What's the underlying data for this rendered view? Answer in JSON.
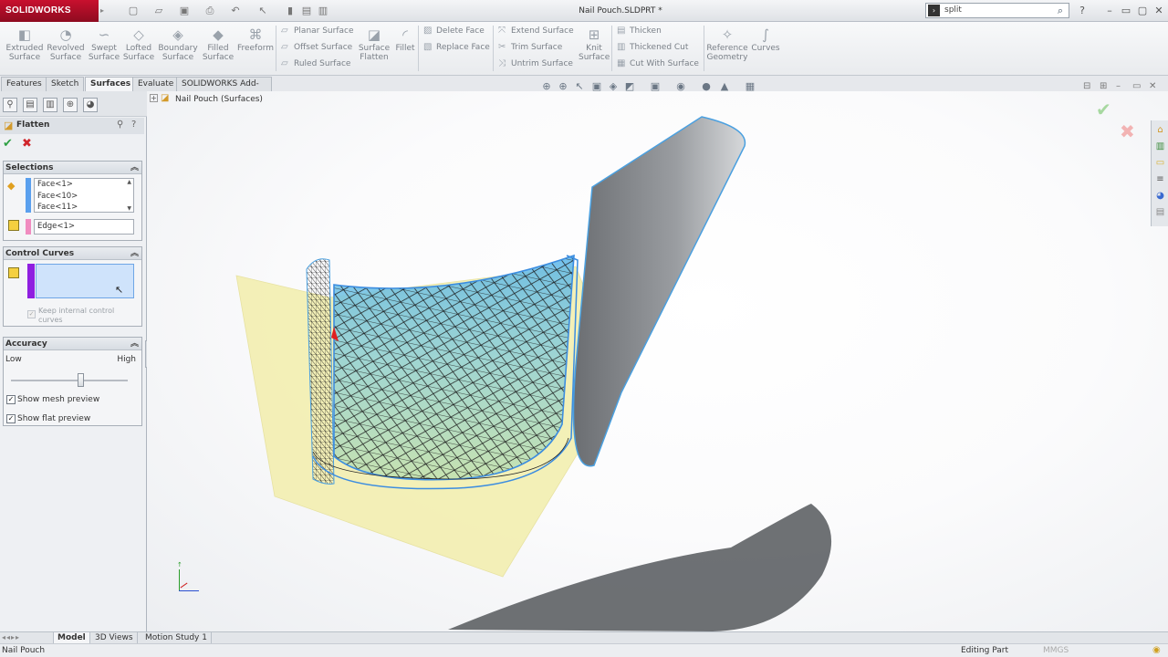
{
  "app": {
    "logo": "SOLIDWORKS",
    "title": "Nail Pouch.SLDPRT *"
  },
  "search": {
    "value": "split"
  },
  "colors": {
    "brand": "#c8102e",
    "accent": "#3c8de0",
    "selection_blue": "#5aa0ee",
    "selection_pink": "#f08cc0",
    "selection_purple": "#8f1fe0"
  },
  "ribbon": {
    "big_buttons": [
      "Extruded Surface",
      "Revolved Surface",
      "Swept Surface",
      "Lofted Surface",
      "Boundary Surface",
      "Filled Surface",
      "Freeform"
    ],
    "group1": [
      "Planar Surface",
      "Offset Surface",
      "Ruled Surface"
    ],
    "surface_flatten": "Surface Flatten",
    "fillet": "Fillet",
    "group2": [
      "Delete Face",
      "Replace Face"
    ],
    "group3": [
      "Extend Surface",
      "Trim Surface",
      "Untrim Surface"
    ],
    "knit": "Knit Surface",
    "group4": [
      "Thicken",
      "Thickened Cut",
      "Cut With Surface"
    ],
    "reference_geometry": "Reference Geometry",
    "curves": "Curves"
  },
  "tabs": [
    "Features",
    "Sketch",
    "Surfaces",
    "Evaluate",
    "SOLIDWORKS Add-Ins"
  ],
  "active_tab": "Surfaces",
  "property_manager": {
    "title": "Flatten",
    "selections": {
      "header": "Selections",
      "faces": [
        "Face<1>",
        "Face<10>",
        "Face<11>"
      ],
      "edge": "Edge<1>"
    },
    "control_curves": {
      "header": "Control Curves",
      "keep_internal": "Keep internal control curves"
    },
    "accuracy": {
      "header": "Accuracy",
      "low": "Low",
      "high": "High",
      "level": 0.6
    },
    "show_mesh_preview": "Show mesh preview",
    "show_flat_preview": "Show flat preview"
  },
  "tree": {
    "root": "Nail Pouch  (Surfaces)"
  },
  "bottom_tabs": [
    "Model",
    "3D Views",
    "Motion Study 1"
  ],
  "status": {
    "left": "Nail Pouch",
    "editing": "Editing Part",
    "units": "MMGS"
  }
}
